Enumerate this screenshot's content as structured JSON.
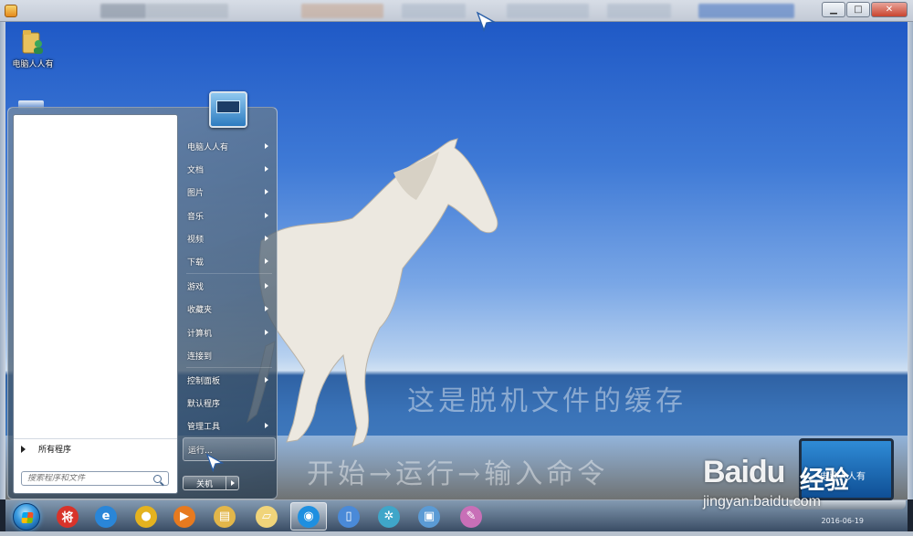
{
  "desktop": {
    "icons": [
      {
        "label": "电脑人人有",
        "icon": "user-folder-icon"
      }
    ],
    "watermark_line1": "这是脱机文件的缓存",
    "watermark_line2": "开始→运行→输入命令"
  },
  "start_menu": {
    "search_placeholder": "搜索程序和文件",
    "all_programs_label": "所有程序",
    "right_items": [
      {
        "label": "电脑人人有",
        "has_submenu": true
      },
      {
        "label": "文档",
        "has_submenu": true
      },
      {
        "label": "图片",
        "has_submenu": true
      },
      {
        "label": "音乐",
        "has_submenu": true
      },
      {
        "label": "视频",
        "has_submenu": true
      },
      {
        "label": "下载",
        "has_submenu": true
      },
      {
        "label": "游戏",
        "has_submenu": true
      },
      {
        "label": "收藏夹",
        "has_submenu": true
      },
      {
        "label": "计算机",
        "has_submenu": true
      },
      {
        "label": "连接到",
        "has_submenu": false
      },
      {
        "label": "控制面板",
        "has_submenu": true
      },
      {
        "label": "默认程序",
        "has_submenu": false
      },
      {
        "label": "管理工具",
        "has_submenu": true
      },
      {
        "label": "运行...",
        "has_submenu": false
      }
    ],
    "shutdown_label": "关机"
  },
  "taskbar": {
    "items": [
      {
        "name": "chinese-chess-icon",
        "glyph": "将",
        "color": "#d8332a"
      },
      {
        "name": "internet-explorer-icon",
        "glyph": "e",
        "color": "#2a86d8"
      },
      {
        "name": "chrome-icon",
        "glyph": "●",
        "color": "#e4b21f"
      },
      {
        "name": "media-player-icon",
        "glyph": "▶",
        "color": "#e77a1f"
      },
      {
        "name": "file-explorer-icon",
        "glyph": "▤",
        "color": "#e2b64a"
      },
      {
        "name": "folder-icon",
        "glyph": "▱",
        "color": "#f0d47a"
      },
      {
        "name": "browser-360-icon",
        "glyph": "◉",
        "color": "#1e8fe0"
      },
      {
        "name": "document-icon",
        "glyph": "▯",
        "color": "#4a8ad8"
      },
      {
        "name": "pinwheel-icon",
        "glyph": "✲",
        "color": "#3fa6c9"
      },
      {
        "name": "remote-desktop-icon",
        "glyph": "▣",
        "color": "#5b9bd5"
      },
      {
        "name": "paint-icon",
        "glyph": "✎",
        "color": "#c86fb7"
      }
    ],
    "clock": "2016-06-19"
  },
  "branding": {
    "baidu": "Baidu",
    "jingyan": "经验",
    "url": "jingyan.baidu.com",
    "laptop_text": "电脑人人有"
  }
}
